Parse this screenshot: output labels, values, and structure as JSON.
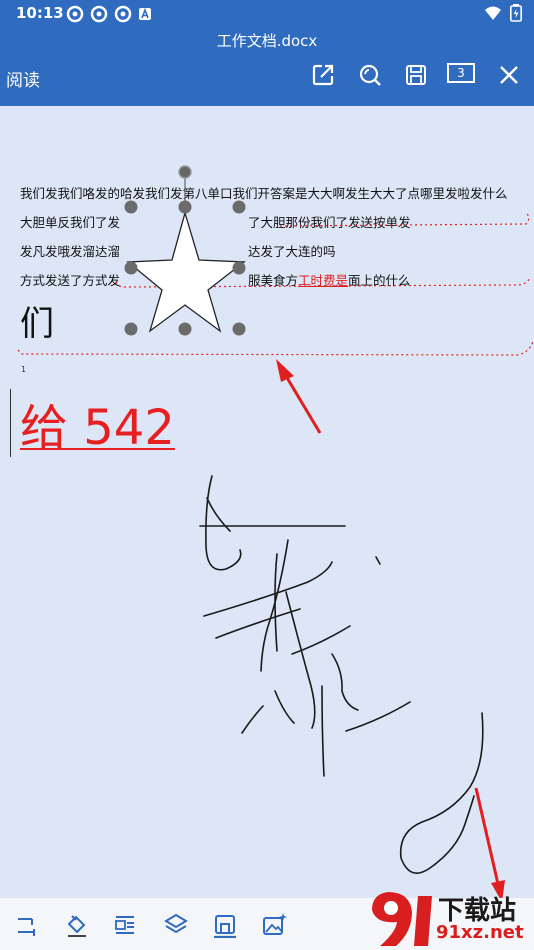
{
  "status": {
    "time": "10:13"
  },
  "app": {
    "doc_title": "工作文档.docx",
    "mode_label": "阅读",
    "page_count": "3"
  },
  "document": {
    "lines": [
      {
        "text": "我们发我们咯发的哈发我们发第八单口我们开答案是大大啊发生大大了点哪里发啦发什么"
      },
      {
        "text": "大胆单反我们了发"
      },
      {
        "text": "了大胆那份我们了发送按单发"
      },
      {
        "text": "发凡发哦发溜达溜"
      },
      {
        "text": "达发了大连的吗"
      },
      {
        "text": "方式发送了方式发"
      },
      {
        "text_before": "服美食方",
        "text_red": "工时费是",
        "text_after": "面上的什么"
      }
    ],
    "big_char": "们",
    "page_number": "1",
    "big_red_text": "给 542"
  },
  "watermark": {
    "title": "下载站",
    "site": "91xz.net"
  },
  "colors": {
    "brand_bar": "#2f6bbf",
    "canvas_bg": "#dce6f7",
    "annotation_red": "#e02020"
  }
}
